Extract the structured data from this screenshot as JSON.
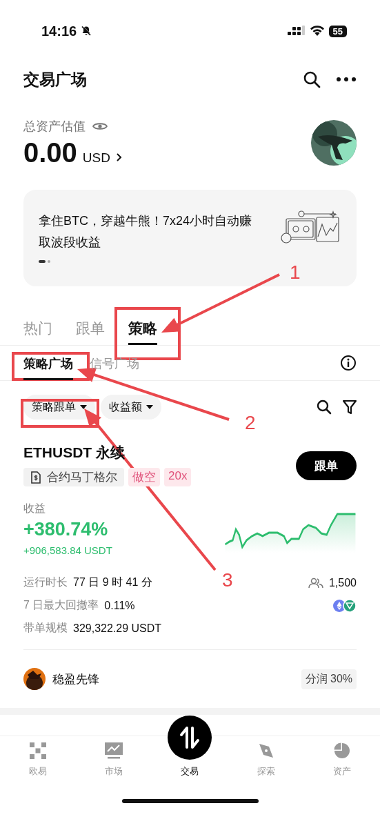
{
  "status_bar": {
    "time": "14:16",
    "battery": "55"
  },
  "header": {
    "title": "交易广场"
  },
  "assets": {
    "label": "总资产估值",
    "value": "0.00",
    "currency": "USD"
  },
  "banner": {
    "text": "拿住BTC，穿越牛熊！7x24小时自动赚取波段收益",
    "pages": [
      {
        "selected": true
      },
      {
        "selected": false
      }
    ]
  },
  "tabs": [
    {
      "label": "热门",
      "selected": false
    },
    {
      "label": "跟单",
      "selected": false
    },
    {
      "label": "策略",
      "selected": true
    }
  ],
  "subtabs": [
    {
      "label": "策略广场",
      "selected": true
    },
    {
      "label": "信号广场",
      "selected": false
    }
  ],
  "filters": [
    {
      "label": "策略跟单"
    },
    {
      "label": "收益额"
    }
  ],
  "strategy": {
    "title": "ETHUSDT 永续",
    "type": "合约马丁格尔",
    "tags": [
      {
        "label": "做空"
      },
      {
        "label": "20x"
      }
    ],
    "follow_button": "跟单",
    "profit_label": "收益",
    "profit_rate": "+380.74%",
    "profit_amount": "+906,583.84 USDT",
    "stats": [
      {
        "label": "运行时长",
        "value": "77 日 9 时 41 分"
      },
      {
        "label": "7 日最大回撤率",
        "value": "0.11%"
      },
      {
        "label": "带单规模",
        "value": "329,322.29 USDT"
      }
    ],
    "followers": "1,500",
    "author": "稳盈先锋",
    "share": "分润 30%"
  },
  "nav": [
    {
      "label": "欧易",
      "selected": false
    },
    {
      "label": "市场",
      "selected": false
    },
    {
      "label": "交易",
      "selected": true
    },
    {
      "label": "探索",
      "selected": false
    },
    {
      "label": "资产",
      "selected": false
    }
  ],
  "annotations": [
    {
      "label": "1"
    },
    {
      "label": "2"
    },
    {
      "label": "3"
    }
  ]
}
